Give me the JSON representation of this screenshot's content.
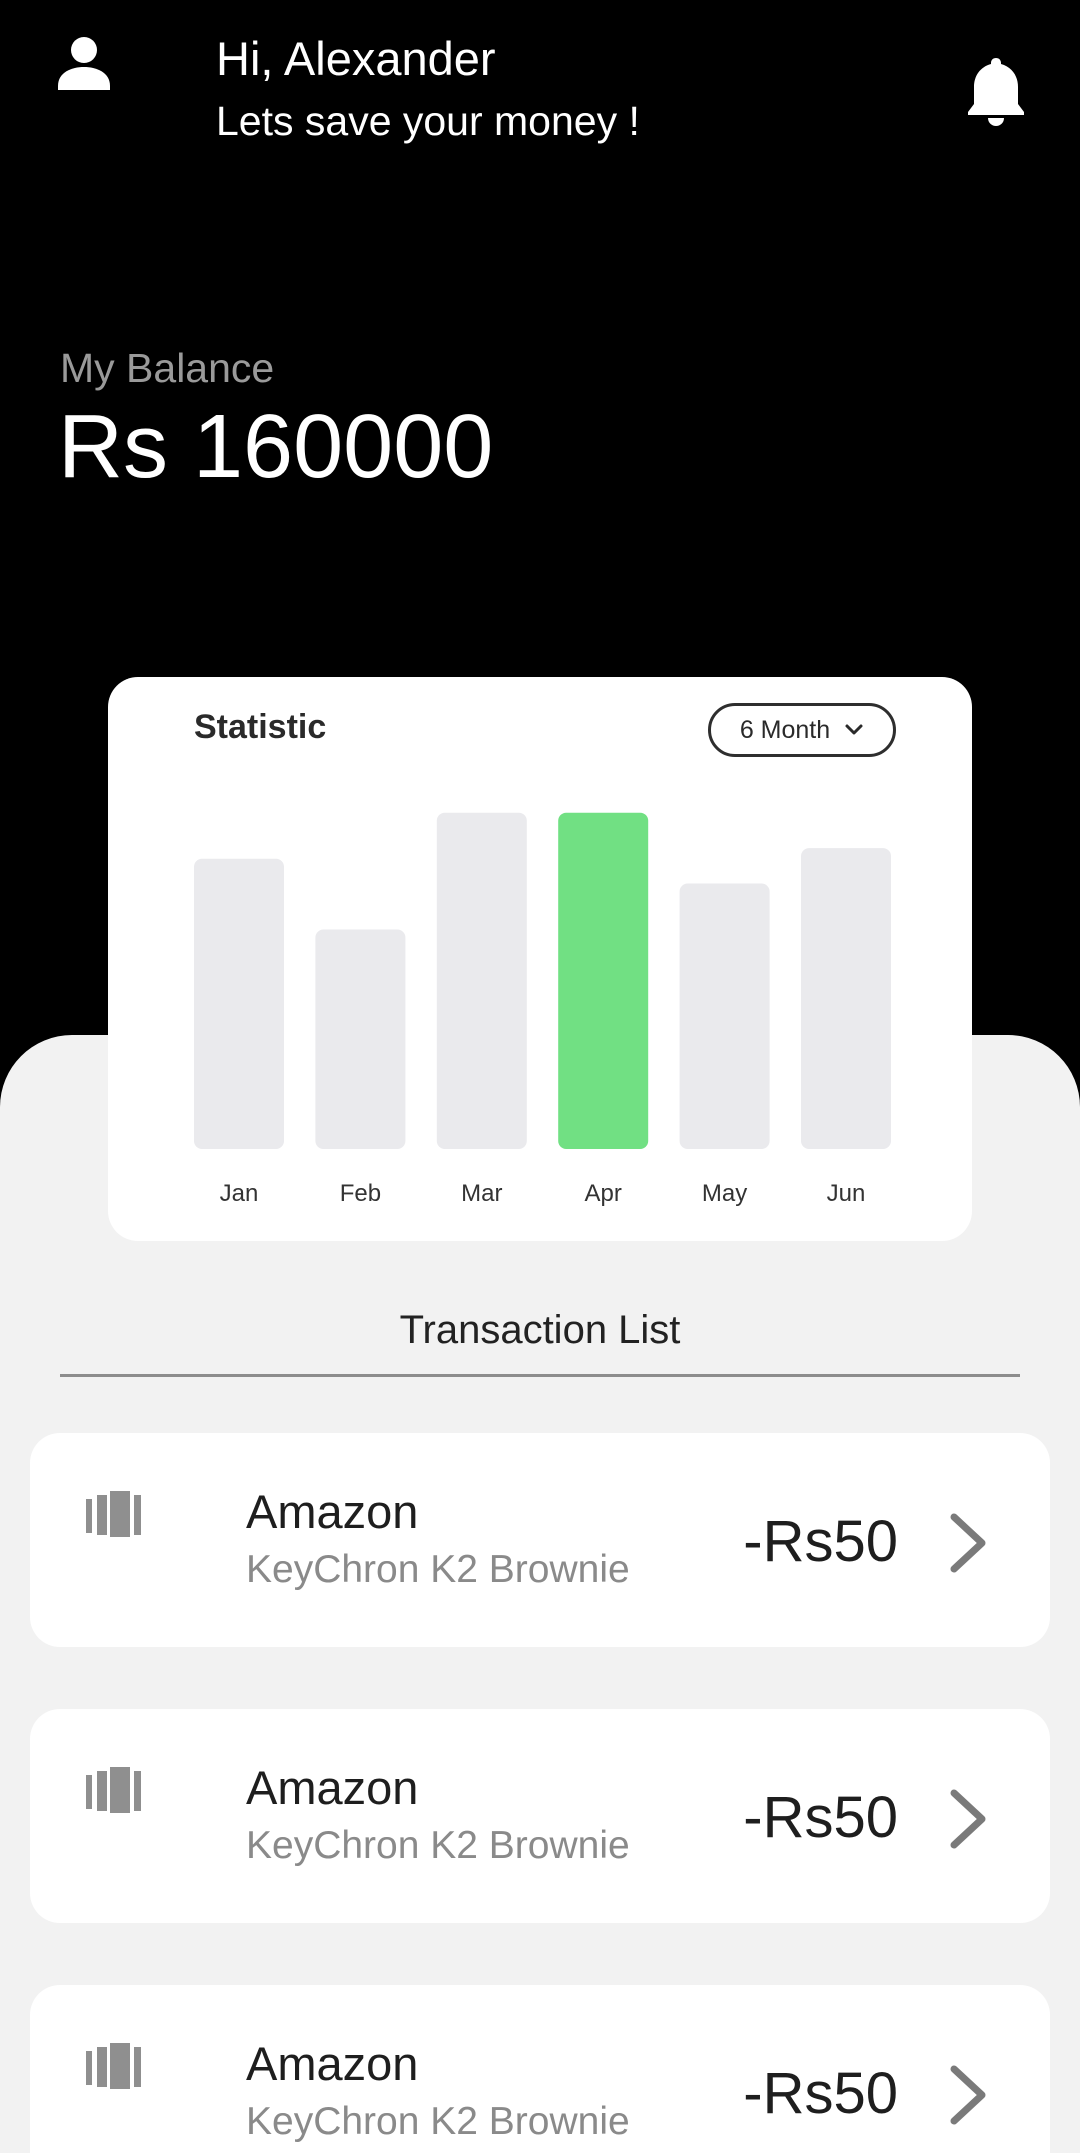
{
  "header": {
    "avatar_icon": "user-icon",
    "greeting": "Hi, Alexander",
    "subtitle": "Lets save your money !",
    "notification_icon": "bell-icon"
  },
  "balance": {
    "label": "My Balance",
    "value": "Rs 160000"
  },
  "statistic": {
    "title": "Statistic",
    "period": "6 Month",
    "highlight_color": "#71e083",
    "bar_color": "#eaeaed"
  },
  "chart_data": {
    "type": "bar",
    "title": "Statistic",
    "categories": [
      "Jan",
      "Feb",
      "Mar",
      "Apr",
      "May",
      "Jun"
    ],
    "values": [
      82,
      62,
      95,
      95,
      75,
      85
    ],
    "highlighted": "Apr",
    "ylim": [
      0,
      100
    ],
    "grid": false,
    "axis_values_shown": false
  },
  "transactions": {
    "title": "Transaction List",
    "items": [
      {
        "icon": "barcode-icon",
        "merchant": "Amazon",
        "item": "KeyChron K2 Brownie",
        "amount": "-Rs50"
      },
      {
        "icon": "barcode-icon",
        "merchant": "Amazon",
        "item": "KeyChron K2 Brownie",
        "amount": "-Rs50"
      },
      {
        "icon": "barcode-icon",
        "merchant": "Amazon",
        "item": "KeyChron K2 Brownie",
        "amount": "-Rs50"
      }
    ]
  }
}
